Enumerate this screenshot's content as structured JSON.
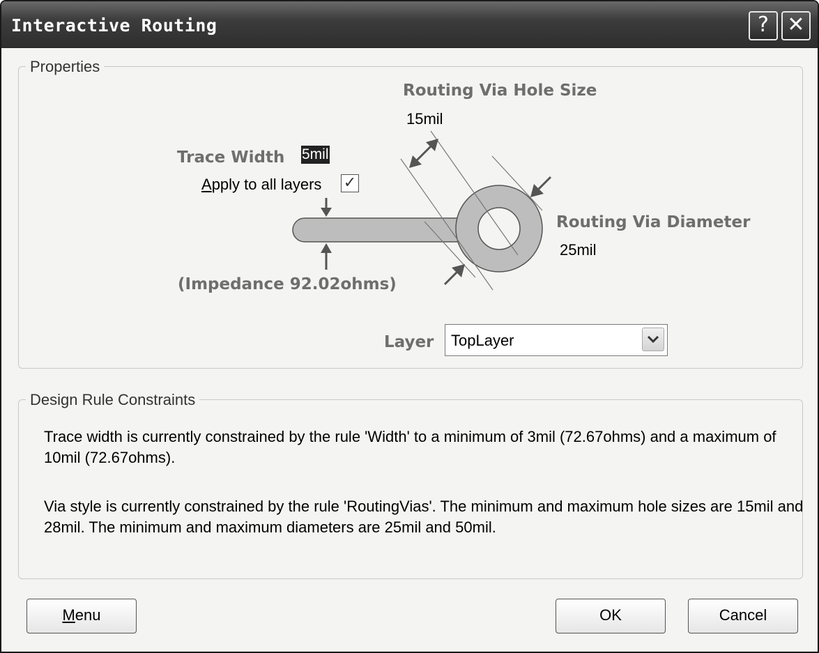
{
  "window": {
    "title": "Interactive Routing",
    "help_glyph": "?",
    "close_glyph": "✕"
  },
  "properties": {
    "legend": "Properties",
    "via_hole_size_label": "Routing Via Hole Size",
    "via_hole_size_value": "15mil",
    "trace_width_label": "Trace Width",
    "trace_width_value": "5mil",
    "apply_all_layers_label_first": "A",
    "apply_all_layers_label_rest": "pply to all layers",
    "apply_all_layers_checked": true,
    "impedance_label": "(Impedance 92.02ohms)",
    "via_diameter_label": "Routing Via Diameter",
    "via_diameter_value": "25mil",
    "layer_label": "Layer",
    "layer_value": "TopLayer"
  },
  "drc": {
    "legend": "Design Rule Constraints",
    "trace_text": "Trace width is currently constrained by the rule 'Width' to a minimum of 3mil (72.67ohms) and a maximum of 10mil (72.67ohms).",
    "via_text": "Via style is currently constrained by the rule 'RoutingVias'. The minimum and maximum hole sizes are 15mil and 28mil. The minimum and maximum diameters are 25mil and 50mil."
  },
  "buttons": {
    "menu_first": "M",
    "menu_rest": "enu",
    "ok": "OK",
    "cancel": "Cancel"
  }
}
